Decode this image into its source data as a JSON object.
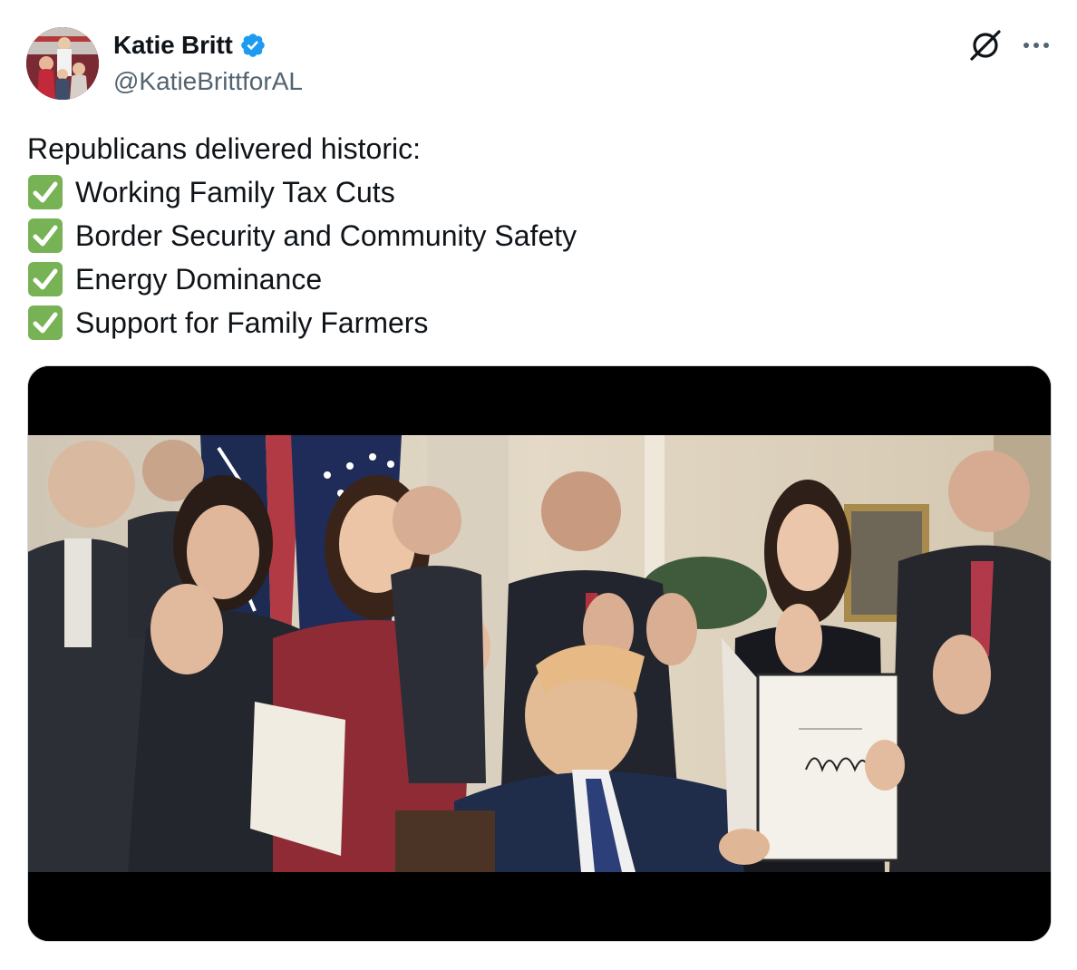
{
  "author": {
    "display_name": "Katie Britt",
    "handle": "@KatieBrittforAL",
    "verified": true,
    "verified_color": "#1d9bf0"
  },
  "header_actions": {
    "grok_icon": "grok-icon",
    "more_icon": "more-options-icon"
  },
  "tweet": {
    "intro": "Republicans delivered historic:",
    "items": [
      "Working Family Tax Cuts",
      "Border Security and Community Safety",
      "Energy Dominance",
      "Support for Family Farmers"
    ],
    "bullet_icon": "check-mark-button-icon",
    "bullet_color": "#77b255"
  },
  "media": {
    "type": "video",
    "letterbox_color": "#000000"
  },
  "colors": {
    "text": "#0f1419",
    "secondary_text": "#536471",
    "border": "#cfd9de"
  }
}
